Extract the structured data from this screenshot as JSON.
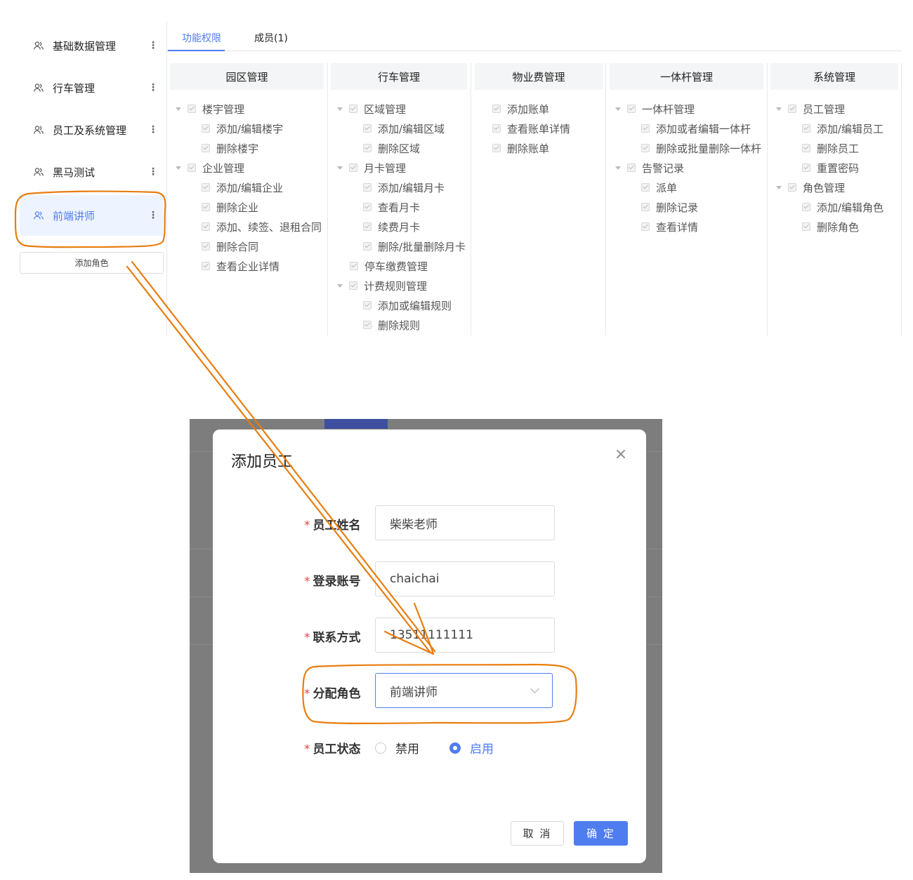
{
  "sidebar": {
    "roles": [
      {
        "label": "基础数据管理",
        "more": "⋮"
      },
      {
        "label": "行车管理",
        "more": "⋮"
      },
      {
        "label": "员工及系统管理",
        "more": "⋮"
      },
      {
        "label": "黑马测试",
        "more": "⋮"
      },
      {
        "label": "前端讲师",
        "more": "⋮"
      }
    ],
    "add_role_label": "添加角色"
  },
  "tabs": [
    {
      "label": "功能权限"
    },
    {
      "label": "成员(1)"
    }
  ],
  "columns": [
    {
      "title": "园区管理",
      "nodes": [
        {
          "label": "楼宇管理"
        },
        {
          "label": "添加/编辑楼宇"
        },
        {
          "label": "删除楼宇"
        },
        {
          "label": "企业管理"
        },
        {
          "label": "添加/编辑企业"
        },
        {
          "label": "删除企业"
        },
        {
          "label": "添加、续签、退租合同"
        },
        {
          "label": "删除合同"
        },
        {
          "label": "查看企业详情"
        }
      ]
    },
    {
      "title": "行车管理",
      "nodes": [
        {
          "label": "区域管理"
        },
        {
          "label": "添加/编辑区域"
        },
        {
          "label": "删除区域"
        },
        {
          "label": "月卡管理"
        },
        {
          "label": "添加/编辑月卡"
        },
        {
          "label": "查看月卡"
        },
        {
          "label": "续费月卡"
        },
        {
          "label": "删除/批量删除月卡"
        },
        {
          "label": "停车缴费管理"
        },
        {
          "label": "计费规则管理"
        },
        {
          "label": "添加或编辑规则"
        },
        {
          "label": "删除规则"
        }
      ]
    },
    {
      "title": "物业费管理",
      "nodes": [
        {
          "label": "添加账单"
        },
        {
          "label": "查看账单详情"
        },
        {
          "label": "删除账单"
        }
      ]
    },
    {
      "title": "一体杆管理",
      "nodes": [
        {
          "label": "一体杆管理"
        },
        {
          "label": "添加或者编辑一体杆"
        },
        {
          "label": "删除或批量删除一体杆"
        },
        {
          "label": "告警记录"
        },
        {
          "label": "派单"
        },
        {
          "label": "删除记录"
        },
        {
          "label": "查看详情"
        }
      ]
    },
    {
      "title": "系统管理",
      "nodes": [
        {
          "label": "员工管理"
        },
        {
          "label": "添加/编辑员工"
        },
        {
          "label": "删除员工"
        },
        {
          "label": "重置密码"
        },
        {
          "label": "角色管理"
        },
        {
          "label": "添加/编辑角色"
        },
        {
          "label": "删除角色"
        }
      ]
    }
  ],
  "modal": {
    "title": "添加员工",
    "close": "×",
    "required_mark": "*",
    "fields": {
      "name": {
        "label": "员工姓名",
        "value": "柴柴老师"
      },
      "account": {
        "label": "登录账号",
        "value": "chaichai"
      },
      "phone": {
        "label": "联系方式",
        "value": "13511111111"
      },
      "role": {
        "label": "分配角色",
        "value": "前端讲师"
      },
      "status": {
        "label": "员工状态",
        "options": [
          "禁用",
          "启用"
        ],
        "selected": "启用"
      }
    },
    "cancel_label": "取 消",
    "ok_label": "确 定"
  },
  "colors": {
    "accent": "#4f7df0",
    "annotation": "#e87d10",
    "required": "#e5484d"
  }
}
